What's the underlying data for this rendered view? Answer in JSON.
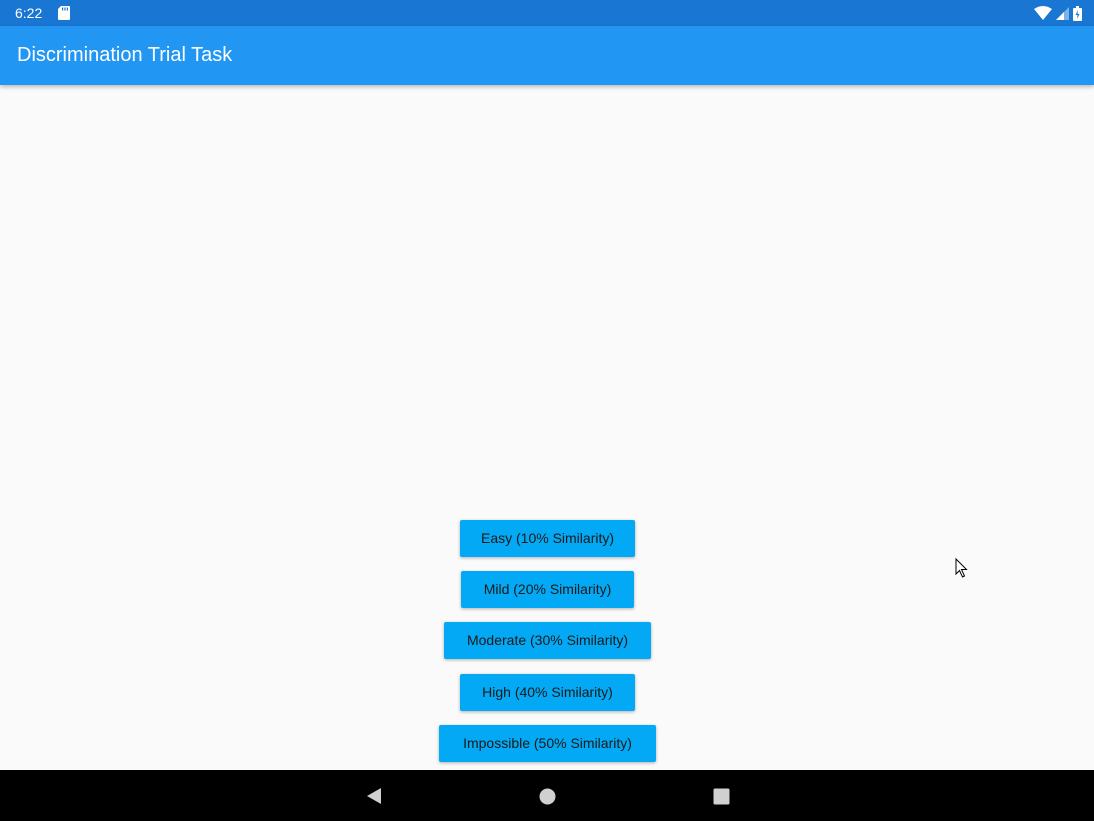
{
  "status_bar": {
    "time": "6:22",
    "icons": [
      "sd-card-icon",
      "wifi-icon",
      "cell-signal-icon",
      "battery-icon"
    ]
  },
  "app_bar": {
    "title": "Discrimination Trial Task",
    "color": "#2196f3"
  },
  "difficulty_buttons": [
    {
      "label": "Easy (10% Similarity)"
    },
    {
      "label": "Mild (20% Similarity)"
    },
    {
      "label": "Moderate (30% Similarity)"
    },
    {
      "label": "High (40% Similarity)"
    },
    {
      "label": "Impossible (50% Similarity)"
    }
  ],
  "colors": {
    "status_bar": "#1976d2",
    "button": "#03a9f4",
    "background": "#fafafa"
  },
  "nav_bar": {
    "icons": [
      "back-icon",
      "home-icon",
      "recents-icon"
    ]
  }
}
